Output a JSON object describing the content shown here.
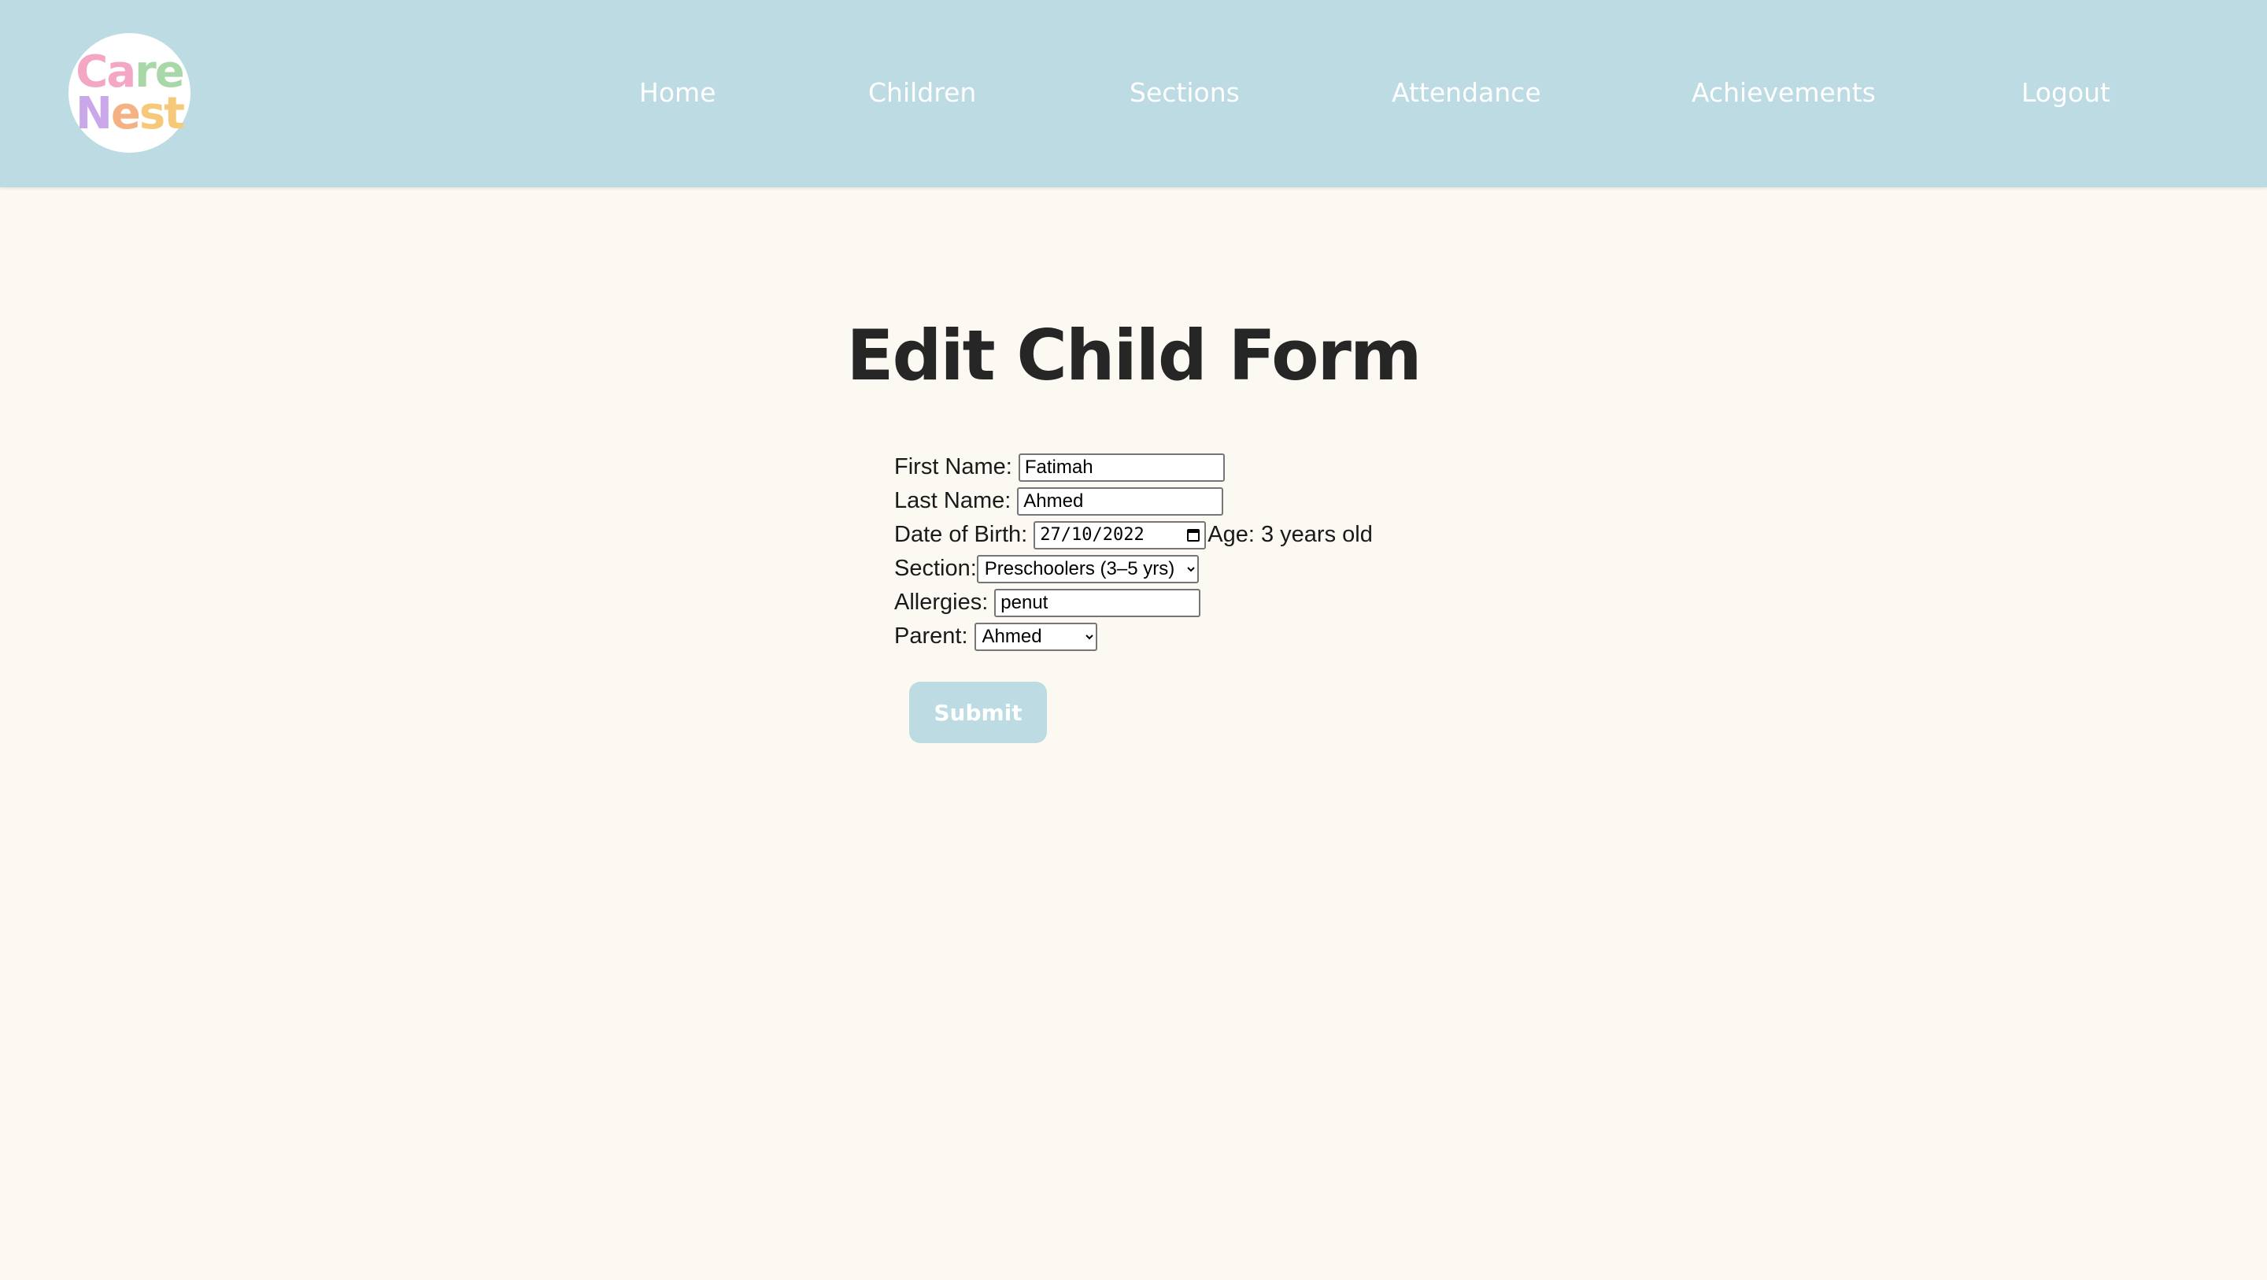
{
  "brand": {
    "logo_line1": [
      "C",
      "a",
      "r",
      "e"
    ],
    "logo_line2": [
      "N",
      "e",
      "s",
      "t"
    ],
    "logo_colors1": [
      "#f4a7c5",
      "#f4a7c5",
      "#a8d8a8",
      "#a8d8a8"
    ],
    "logo_colors2": [
      "#c9a7e8",
      "#f4b183",
      "#f6c97a",
      "#f6c97a"
    ]
  },
  "nav": {
    "home": "Home",
    "children": "Children",
    "sections": "Sections",
    "attendance": "Attendance",
    "achievements": "Achievements",
    "logout": "Logout"
  },
  "page": {
    "title": "Edit Child Form"
  },
  "form": {
    "first_name_label": "First Name:",
    "first_name_value": "Fatimah",
    "last_name_label": "Last Name:",
    "last_name_value": "Ahmed",
    "dob_label": "Date of Birth:",
    "dob_value": "27/10/2022",
    "age_text": "Age: 3 years old",
    "section_label": "Section:",
    "section_selected": "Preschoolers (3–5 yrs)",
    "allergies_label": "Allergies:",
    "allergies_value": "penut",
    "parent_label": "Parent:",
    "parent_selected": "Ahmed",
    "submit_label": "Submit"
  },
  "colors": {
    "navbar_bg": "#bcdbe2",
    "page_bg": "#fcf9f2",
    "nav_text": "#ffffff",
    "title_text": "#262626"
  }
}
